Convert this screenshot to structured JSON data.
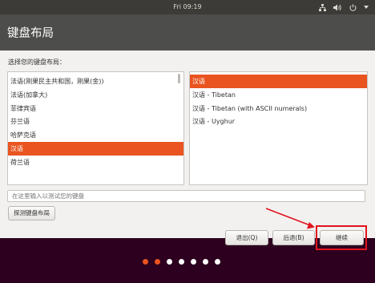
{
  "topbar": {
    "clock": "Fri 09:19"
  },
  "window": {
    "title": "键盘布局",
    "prompt": "选择您的键盘布局：",
    "layouts": [
      "法语(刚果民主共和国，刚果(金))",
      "法语(加拿大)",
      "菲律宾语",
      "芬兰语",
      "哈萨克语",
      "汉语",
      "荷兰语"
    ],
    "selected_layout_index": 5,
    "variants": [
      "汉语",
      "汉语 - Tibetan",
      "汉语 - Tibetan (with ASCII numerals)",
      "汉语 - Uyghur"
    ],
    "selected_variant_index": 0,
    "test_placeholder": "在这里输入以测试您的键盘",
    "detect_label": "探测键盘布局",
    "quit_label": "退出(Q)",
    "back_label": "后退(B)",
    "continue_label": "继续"
  },
  "progress": {
    "total": 7,
    "completed": 2
  },
  "colors": {
    "accent": "#e95420",
    "annotation": "#e0141e"
  }
}
